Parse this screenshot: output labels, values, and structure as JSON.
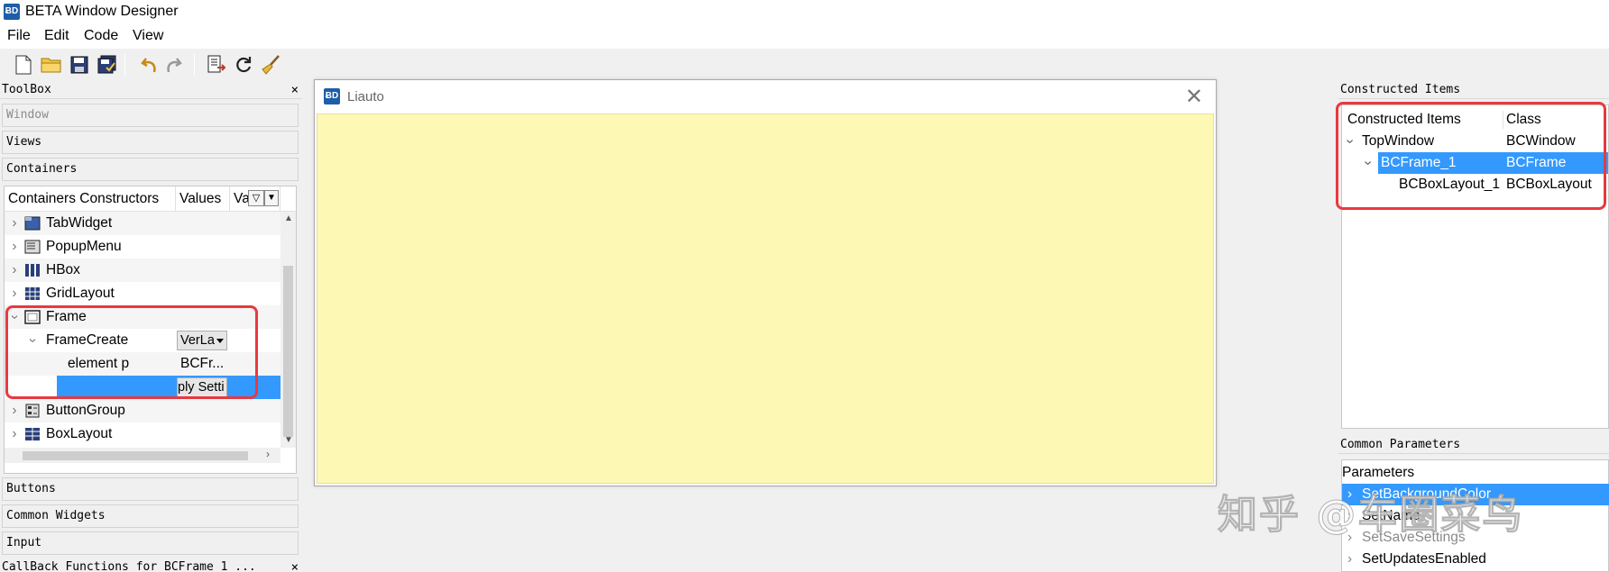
{
  "window": {
    "title": "BETA Window Designer",
    "icon": "app-logo-icon"
  },
  "menu": [
    "File",
    "Edit",
    "Code",
    "View"
  ],
  "toolbar": {
    "buttons": [
      "new-file-icon",
      "open-folder-icon",
      "save-icon",
      "save-all-icon",
      "undo-icon",
      "redo-icon",
      "export-code-icon",
      "refresh-icon",
      "clean-broom-icon"
    ]
  },
  "toolbox": {
    "title": "ToolBox",
    "close": "×",
    "sections_top": [
      "Window",
      "Views",
      "Containers"
    ],
    "tree": {
      "headers": [
        "Containers Constructors",
        "Values",
        "Va"
      ],
      "items": [
        {
          "label": "TabWidget",
          "icon": "tabwidget-icon"
        },
        {
          "label": "PopupMenu",
          "icon": "popupmenu-icon"
        },
        {
          "label": "HBox",
          "icon": "hbox-icon"
        },
        {
          "label": "GridLayout",
          "icon": "gridlayout-icon"
        },
        {
          "label": "Frame",
          "icon": "frame-icon"
        },
        {
          "label": "FrameCreate",
          "value": "VerLa"
        },
        {
          "label": "element p",
          "value": "BCFr..."
        },
        {
          "label": "",
          "value": "ply Setti"
        },
        {
          "label": "ButtonGroup",
          "icon": "buttongroup-icon"
        },
        {
          "label": "BoxLayout",
          "icon": "boxlayout-icon"
        }
      ]
    },
    "sections_bottom": [
      "Buttons",
      "Common Widgets",
      "Input"
    ],
    "callback_title": "CallBack Functions for BCFrame_1 ..."
  },
  "designer_window": {
    "title": "Liauto",
    "close": "✕",
    "client_color": "#fdf8b4"
  },
  "constructed_items": {
    "dock_title": "Constructed Items",
    "headers": [
      "Constructed Items",
      "Class"
    ],
    "rows": [
      {
        "name": "TopWindow",
        "class": "BCWindow"
      },
      {
        "name": "BCFrame_1",
        "class": "BCFrame"
      },
      {
        "name": "BCBoxLayout_1",
        "class": "BCBoxLayout"
      }
    ]
  },
  "common_parameters": {
    "dock_title": "Common Parameters",
    "header": "Parameters",
    "rows": [
      "SetBackgroundColor",
      "SetName",
      "SetSaveSettings",
      "SetUpdatesEnabled"
    ]
  },
  "watermark": "知乎 @车圈菜鸟",
  "colors": {
    "selection": "#3399ff",
    "highlight_box": "#e8393f",
    "canvas": "#fdf8b4"
  }
}
